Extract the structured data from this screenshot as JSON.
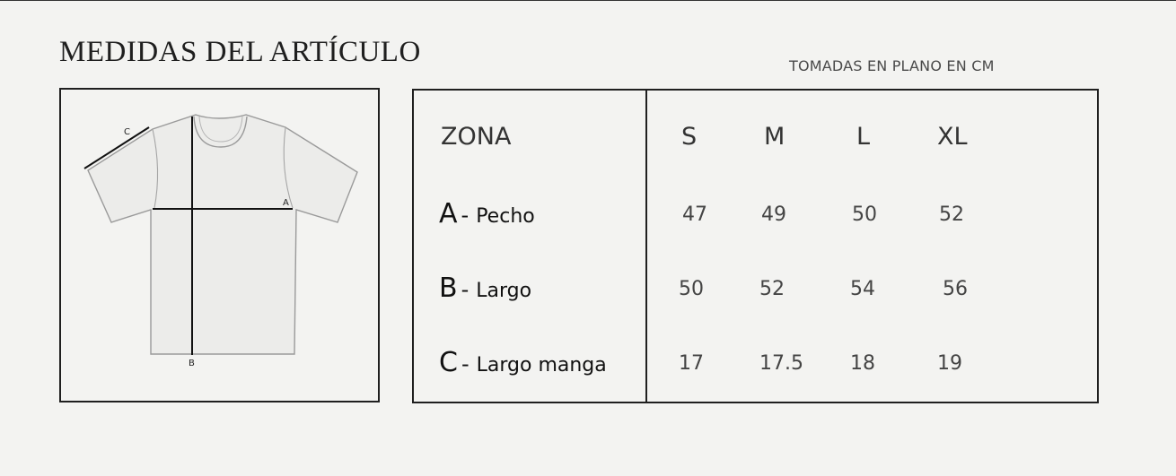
{
  "title": "MEDIDAS DEL ARTÍCULO",
  "subtitle": "TOMADAS EN PLANO EN CM",
  "diagram": {
    "label_a": "A",
    "label_b": "B",
    "label_c": "C"
  },
  "table": {
    "header_zone": "ZONA",
    "sizes": [
      "S",
      "M",
      "L",
      "XL"
    ],
    "rows": [
      {
        "letter": "A",
        "dash": "-",
        "label": "Pecho",
        "values": [
          "47",
          "49",
          "50",
          "52"
        ]
      },
      {
        "letter": "B",
        "dash": "-",
        "label": "Largo",
        "values": [
          "50",
          "52",
          "54",
          "56"
        ]
      },
      {
        "letter": "C",
        "dash": "-",
        "label": "Largo manga",
        "values": [
          "17",
          "17.5",
          "18",
          "19"
        ]
      }
    ]
  }
}
